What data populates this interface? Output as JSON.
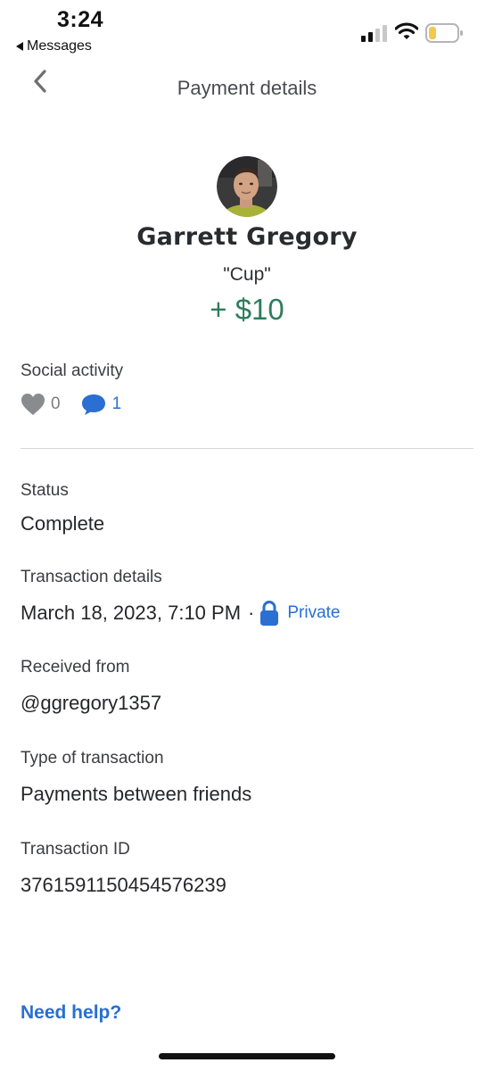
{
  "status_bar": {
    "time": "3:24",
    "back_app": "Messages",
    "signal_icon": "cellular-signal-icon",
    "wifi_icon": "wifi-icon",
    "battery_icon": "battery-low-icon",
    "battery_color": "#f2c94c"
  },
  "header": {
    "title": "Payment details",
    "back_icon": "chevron-left-icon"
  },
  "payment": {
    "counterparty_name": "Garrett Gregory",
    "note": "\"Cup\"",
    "amount": "+ $10",
    "amount_color": "#2e7d5b"
  },
  "social": {
    "label": "Social activity",
    "like_icon": "heart-icon",
    "likes": "0",
    "comment_icon": "comment-bubble-icon",
    "comments": "1"
  },
  "details": {
    "status_label": "Status",
    "status_value": "Complete",
    "transaction_label": "Transaction details",
    "transaction_date": "March 18, 2023, 7:10 PM",
    "separator": "·",
    "privacy_icon": "lock-icon",
    "privacy_value": "Private",
    "received_label": "Received from",
    "received_value": "@ggregory1357",
    "type_label": "Type of transaction",
    "type_value": "Payments between friends",
    "id_label": "Transaction ID",
    "id_value": "3761591150454576239"
  },
  "footer": {
    "help_link": "Need help?"
  },
  "colors": {
    "link_blue": "#2a6fd1",
    "heart_gray": "#8a8b8f"
  }
}
